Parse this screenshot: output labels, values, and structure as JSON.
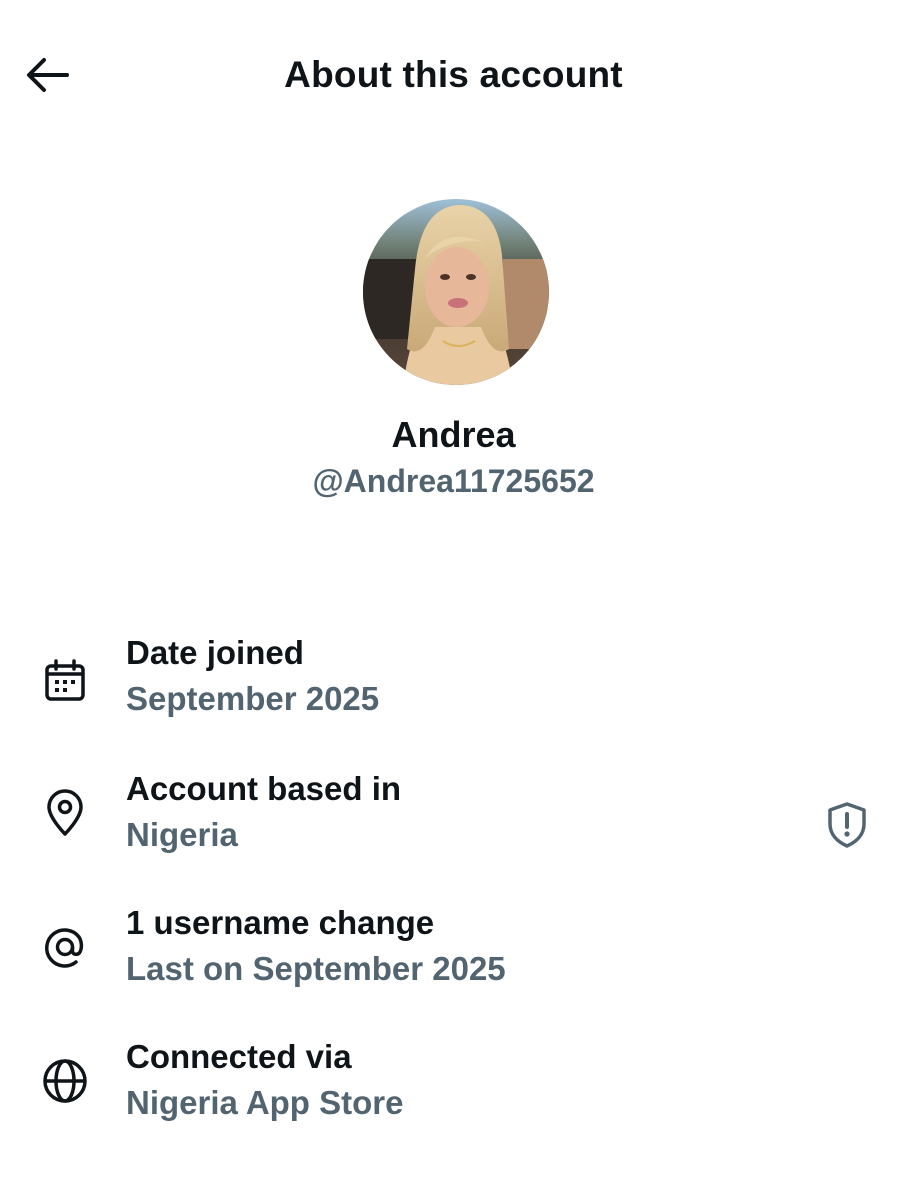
{
  "header": {
    "title": "About this account",
    "back_icon": "arrow-left-icon"
  },
  "profile": {
    "display_name": "Andrea",
    "handle": "@Andrea11725652"
  },
  "rows": [
    {
      "icon": "calendar-icon",
      "title": "Date joined",
      "value": "September 2025"
    },
    {
      "icon": "location-pin-icon",
      "title": "Account based in",
      "value": "Nigeria",
      "trailing_icon": "shield-alert-icon"
    },
    {
      "icon": "at-sign-icon",
      "title": "1 username change",
      "value": "Last on September 2025"
    },
    {
      "icon": "globe-icon",
      "title": "Connected via",
      "value": "Nigeria App Store"
    }
  ],
  "colors": {
    "primary_text": "#0f1419",
    "secondary_text": "#536471"
  }
}
